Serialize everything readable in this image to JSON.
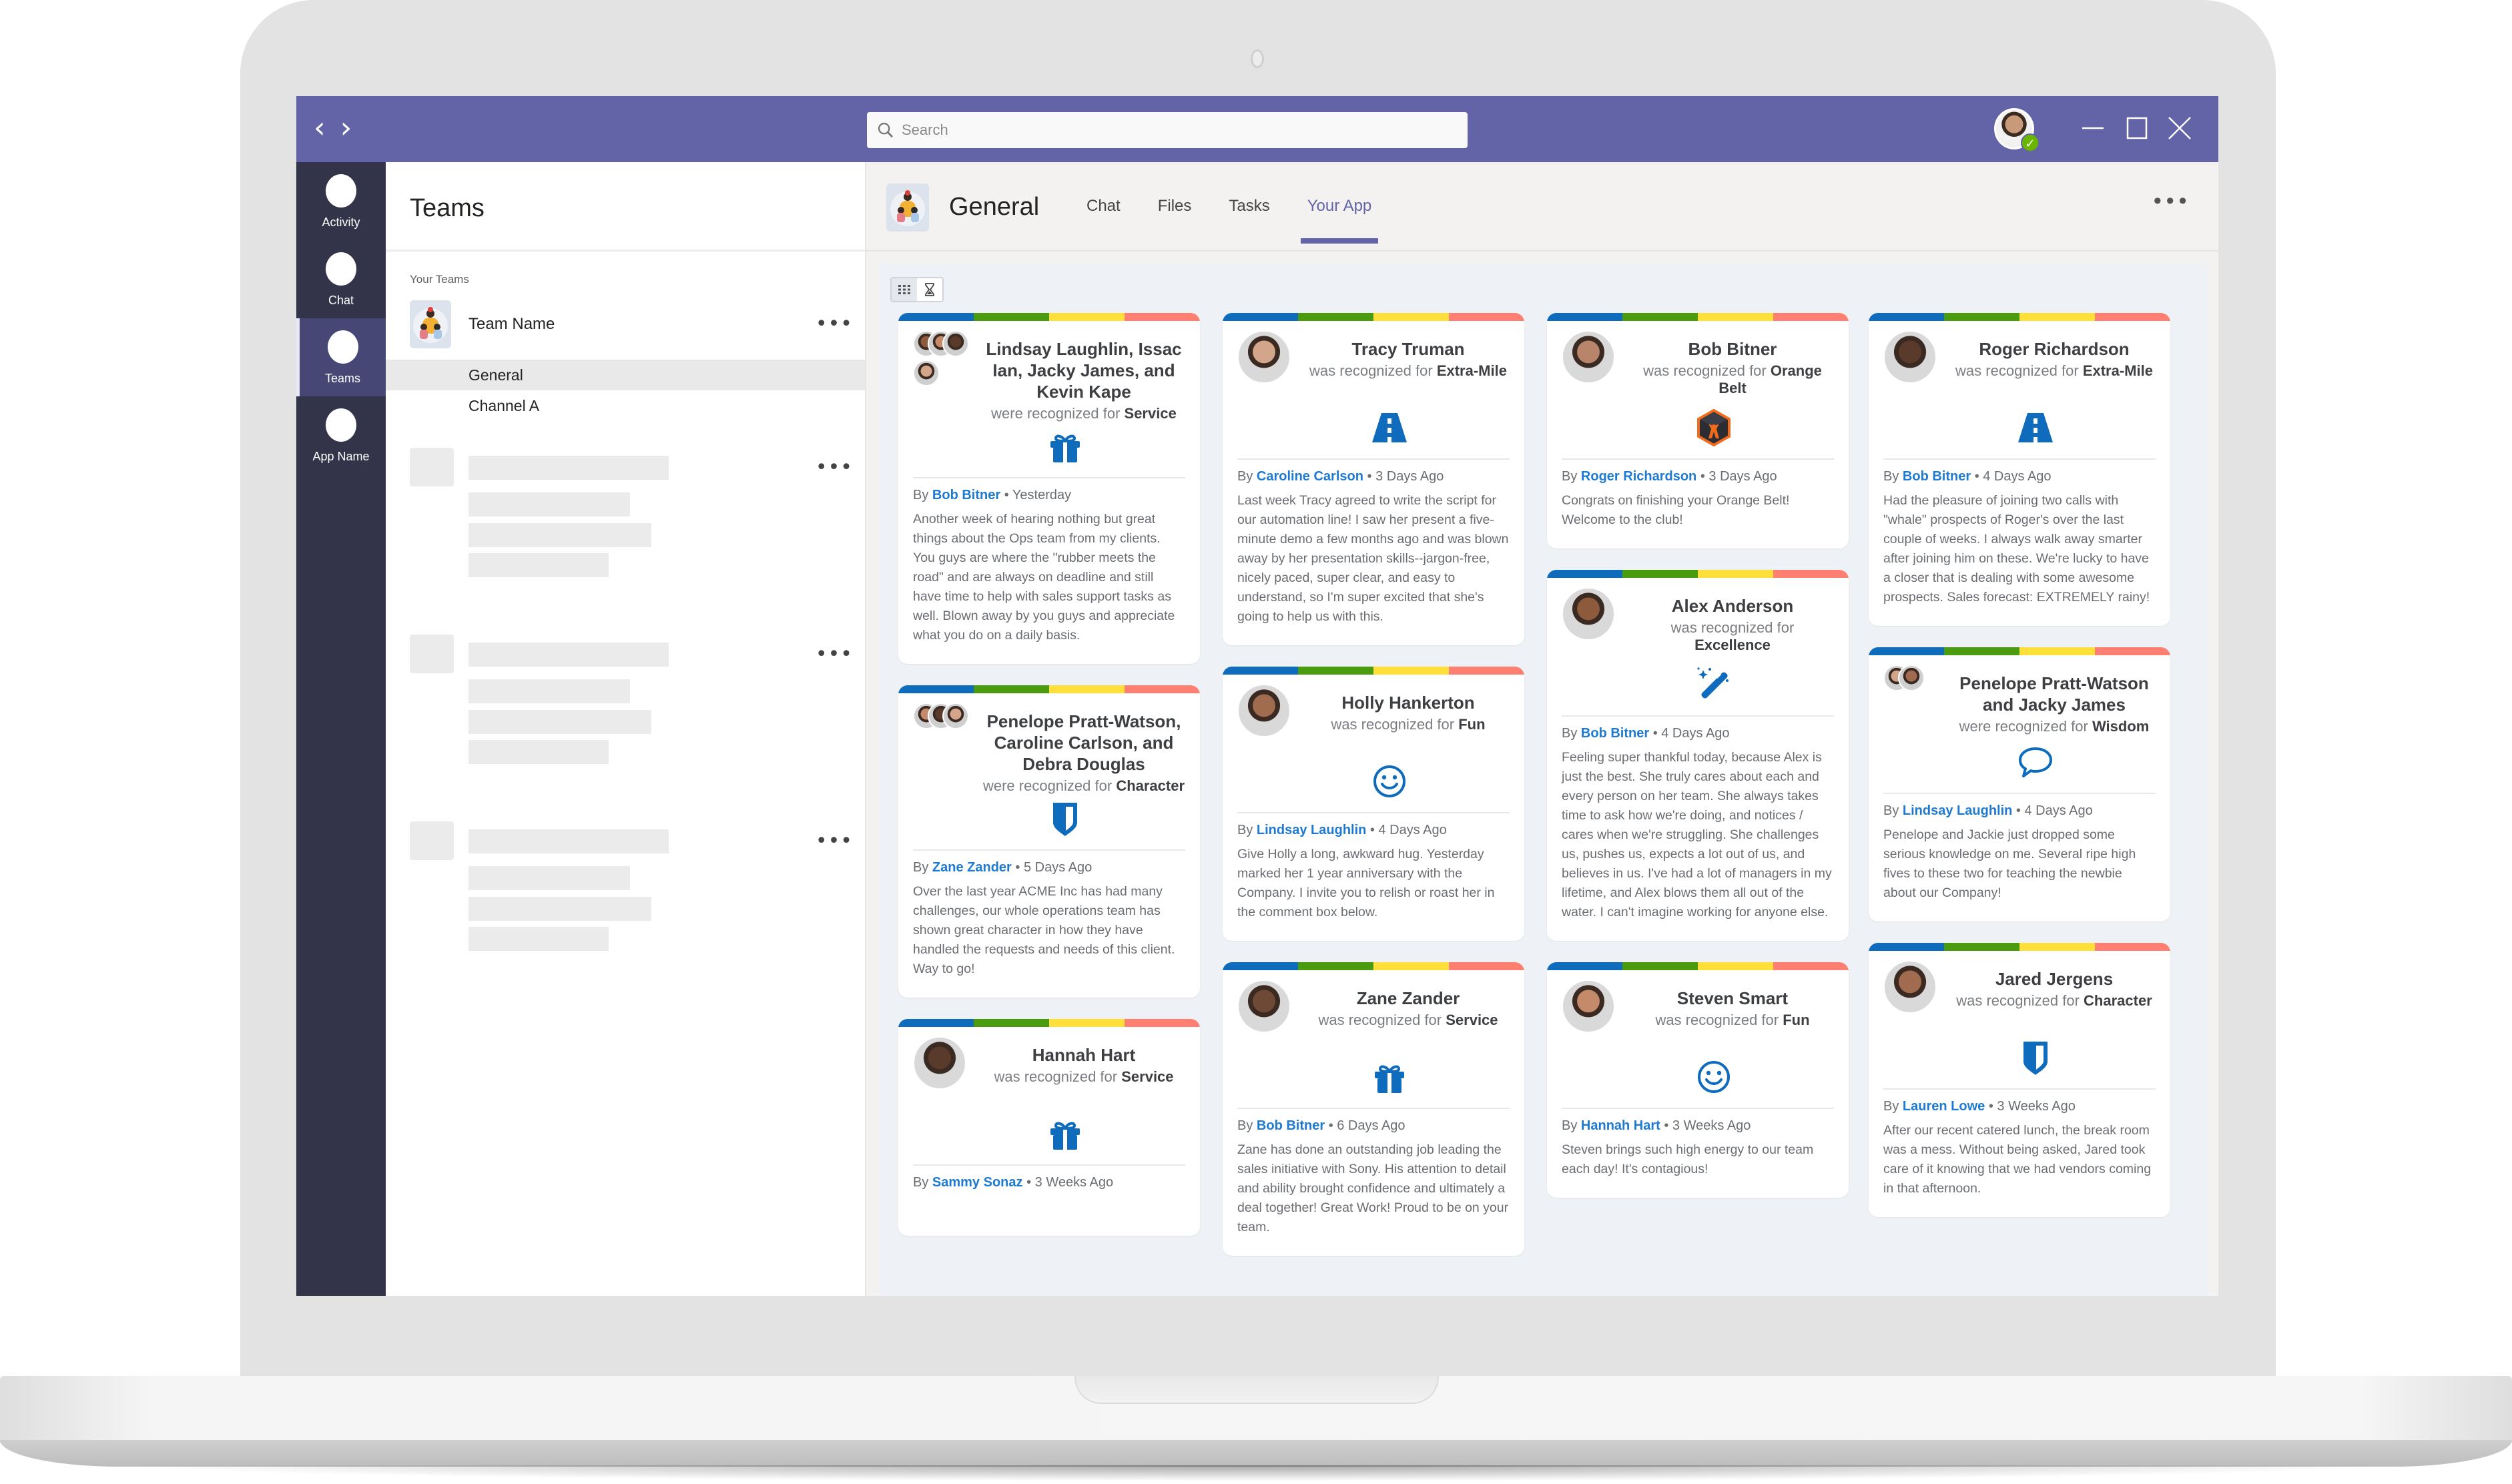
{
  "window": {
    "search_placeholder": "Search",
    "presence": "✓"
  },
  "rail": {
    "items": [
      {
        "label": "Activity",
        "active": false
      },
      {
        "label": "Chat",
        "active": false
      },
      {
        "label": "Teams",
        "active": true
      },
      {
        "label": "App Name",
        "active": false
      }
    ]
  },
  "left_panel": {
    "title": "Teams",
    "section_label": "Your Teams",
    "team": {
      "name": "Team Name",
      "more": "•••"
    },
    "channels": [
      {
        "name": "General",
        "selected": true
      },
      {
        "name": "Channel A",
        "selected": false
      }
    ],
    "more": "•••"
  },
  "main": {
    "channel_title": "General",
    "tabs": [
      {
        "label": "Chat",
        "active": false
      },
      {
        "label": "Files",
        "active": false
      },
      {
        "label": "Tasks",
        "active": false
      },
      {
        "label": "Your App",
        "active": true
      }
    ],
    "more": "•••",
    "view_toggle": [
      "grid-view",
      "timeline-view"
    ]
  },
  "stripe_colors": [
    "#0f6cbd",
    "#4b9b0f",
    "#ffe03b",
    "#ff7f72"
  ],
  "accent_color": "#1d79d2",
  "cards": [
    {
      "column": 0,
      "recipients": "Lindsay Laughlin, Issac Ian, Jacky James, and Kevin Kape",
      "verb": "were recognized for",
      "value": "Service",
      "icon": "gift-icon",
      "by_label": "By",
      "author": "Bob Bitner",
      "time": "• Yesterday",
      "message": "Another week of hearing nothing but great things about the Ops team from my clients. You guys are where the \"rubber meets the road\" and are always on deadline and still have time to help with sales support tasks as well. Blown away by you guys and appreciate what you do on a daily basis."
    },
    {
      "column": 0,
      "recipients": "Penelope Pratt-Watson, Caroline Carlson, and Debra Douglas",
      "verb": "were recognized for",
      "value": "Character",
      "icon": "shield-icon",
      "by_label": "By",
      "author": "Zane Zander",
      "time": "• 5 Days Ago",
      "message": "Over the last year ACME Inc has had many challenges, our whole operations team has shown great character in how they have handled the requests and needs of this client. Way to go!"
    },
    {
      "column": 0,
      "recipients": "Hannah Hart",
      "verb": "was recognized for",
      "value": "Service",
      "icon": "gift-icon",
      "by_label": "By",
      "author": "Sammy Sonaz",
      "time": "• 3 Weeks Ago",
      "message": ""
    },
    {
      "column": 1,
      "recipients": "Tracy Truman",
      "verb": "was recognized for",
      "value": "Extra-Mile",
      "icon": "road-icon",
      "by_label": "By",
      "author": "Caroline Carlson",
      "time": "• 3 Days Ago",
      "message": "Last week Tracy agreed to write the script for our automation line! I saw her present a five-minute demo a few months ago and was blown away by her presentation skills--jargon-free, nicely paced, super clear, and easy to understand, so I'm super excited that she's going to help us with this."
    },
    {
      "column": 1,
      "recipients": "Holly Hankerton",
      "verb": "was recognized for",
      "value": "Fun",
      "icon": "smiley-icon",
      "by_label": "By",
      "author": "Lindsay Laughlin",
      "time": "• 4 Days Ago",
      "message": "Give Holly a long, awkward hug. Yesterday marked her 1 year anniversary with the Company. I invite you to relish or roast her in the comment box below."
    },
    {
      "column": 1,
      "recipients": "Zane Zander",
      "verb": "was recognized for",
      "value": "Service",
      "icon": "gift-icon",
      "by_label": "By",
      "author": "Bob Bitner",
      "time": "• 6 Days Ago",
      "message": "Zane has done an outstanding job leading the sales initiative with Sony. His attention to detail and ability brought confidence and ultimately a deal together! Great Work! Proud to be on your team."
    },
    {
      "column": 2,
      "recipients": "Bob Bitner",
      "verb": "was recognized for",
      "value": "Orange Belt",
      "icon": "orange-belt-badge-icon",
      "by_label": "By",
      "author": "Roger Richardson",
      "time": "• 3 Days Ago",
      "message": "Congrats on finishing your Orange Belt! Welcome to the club!"
    },
    {
      "column": 2,
      "recipients": "Alex Anderson",
      "verb": "was recognized for",
      "value": "Excellence",
      "icon": "magic-wand-icon",
      "by_label": "By",
      "author": "Bob Bitner",
      "time": "• 4 Days Ago",
      "message": "Feeling super thankful today, because Alex is just the best. She truly cares about each and every person on her team. She always takes time to ask how we're doing, and notices / cares when we're struggling. She challenges us, pushes us, expects a lot out of us, and believes in us. I've had a lot of managers in my lifetime, and Alex blows them all out of the water. I can't imagine working for anyone else."
    },
    {
      "column": 2,
      "recipients": "Steven Smart",
      "verb": "was recognized for",
      "value": "Fun",
      "icon": "smiley-icon",
      "by_label": "By",
      "author": "Hannah Hart",
      "time": "• 3 Weeks Ago",
      "message": "Steven brings such high energy to our team each day! It's contagious!"
    },
    {
      "column": 3,
      "recipients": "Roger Richardson",
      "verb": "was recognized for",
      "value": "Extra-Mile",
      "icon": "road-icon",
      "by_label": "By",
      "author": "Bob Bitner",
      "time": "• 4 Days Ago",
      "message": "Had the pleasure of joining two calls with \"whale\" prospects of Roger's over the last couple of weeks. I always walk away smarter after joining him on these. We're lucky to have a closer that is dealing with some awesome prospects. Sales forecast: EXTREMELY rainy!"
    },
    {
      "column": 3,
      "recipients": "Penelope Pratt-Watson and Jacky James",
      "verb": "were recognized for",
      "value": "Wisdom",
      "icon": "speech-bubble-icon",
      "by_label": "By",
      "author": "Lindsay Laughlin",
      "time": "• 4 Days Ago",
      "message": "Penelope and Jackie just dropped some serious knowledge on me. Several ripe high fives to these two for teaching the newbie about our Company!"
    },
    {
      "column": 3,
      "recipients": "Jared Jergens",
      "verb": "was recognized for",
      "value": "Character",
      "icon": "shield-icon",
      "by_label": "By",
      "author": "Lauren Lowe",
      "time": "• 3 Weeks Ago",
      "message": "After our recent catered lunch, the break room was a mess. Without being asked, Jared took care of it knowing that we had vendors coming in that afternoon."
    }
  ]
}
